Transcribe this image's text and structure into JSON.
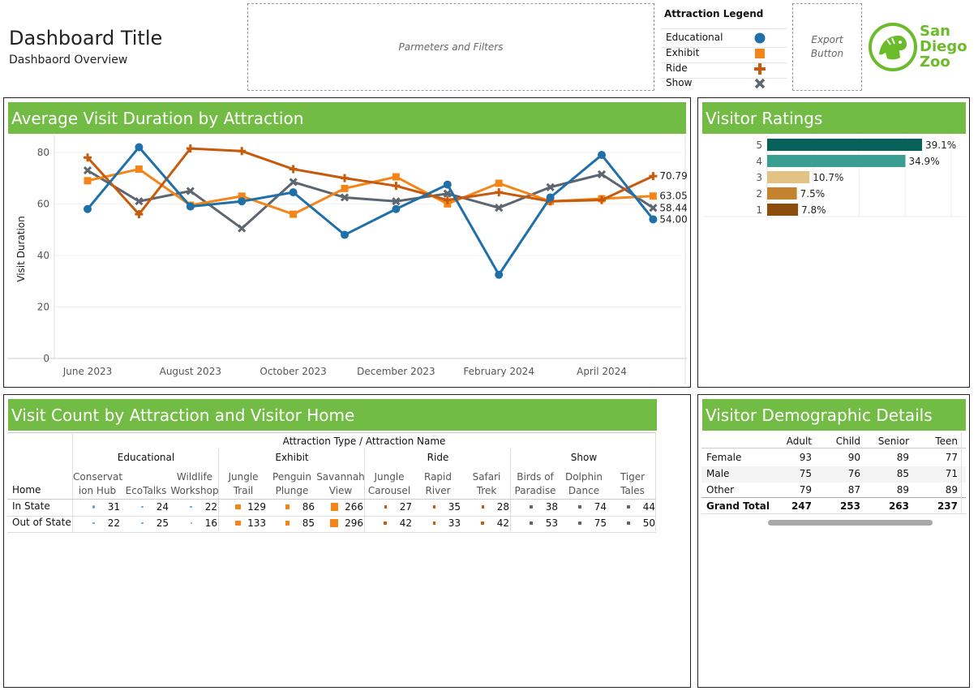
{
  "header": {
    "title": "Dashboard Title",
    "subtitle": "Dashbaord Overview",
    "filters_placeholder": "Parmeters and Filters",
    "export_line1": "Export",
    "export_line2": "Button",
    "logo_text": [
      "San",
      "Diego",
      "Zoo"
    ]
  },
  "legend": {
    "title": "Attraction Legend",
    "items": [
      {
        "label": "Educational",
        "shape": "circle",
        "color": "#1f6fa8"
      },
      {
        "label": "Exhibit",
        "shape": "square",
        "color": "#f58518"
      },
      {
        "label": "Ride",
        "shape": "plus",
        "color": "#c85a0c"
      },
      {
        "label": "Show",
        "shape": "cross",
        "color": "#5d6570"
      }
    ]
  },
  "line_panel": {
    "title": "Average Visit Duration by Attraction"
  },
  "ratings_panel": {
    "title": "Visitor Ratings"
  },
  "counts_panel": {
    "title": "Visit Count by Attraction and Visitor Home",
    "header_top": "Attraction Type / Attraction Name",
    "row_header": "Home",
    "groups": [
      "Educational",
      "Exhibit",
      "Ride",
      "Show"
    ],
    "columns": [
      [
        "Conservat",
        "ion Hub"
      ],
      [
        "",
        "EcoTalks"
      ],
      [
        "Wildlife",
        "Workshop"
      ],
      [
        "Jungle",
        "Trail"
      ],
      [
        "Penguin",
        "Plunge"
      ],
      [
        "Savannah",
        "View"
      ],
      [
        "Jungle",
        "Carousel"
      ],
      [
        "Rapid",
        "River"
      ],
      [
        "Safari",
        "Trek"
      ],
      [
        "Birds of",
        "Paradise"
      ],
      [
        "Dolphin",
        "Dance"
      ],
      [
        "Tiger",
        "Tales"
      ]
    ],
    "rows": [
      {
        "label": "In State",
        "values": [
          "31",
          "24",
          "22",
          "129",
          "86",
          "266",
          "27",
          "35",
          "28",
          "38",
          "74",
          "44"
        ]
      },
      {
        "label": "Out of State",
        "values": [
          "22",
          "25",
          "16",
          "133",
          "85",
          "296",
          "42",
          "33",
          "42",
          "53",
          "75",
          "50"
        ]
      }
    ]
  },
  "demographics_panel": {
    "title": "Visitor Demographic Details",
    "columns": [
      "Adult",
      "Child",
      "Senior",
      "Teen"
    ],
    "rows": [
      {
        "label": "Female",
        "values": [
          "93",
          "90",
          "89",
          "77"
        ]
      },
      {
        "label": "Male",
        "values": [
          "75",
          "76",
          "85",
          "71"
        ]
      },
      {
        "label": "Other",
        "values": [
          "79",
          "87",
          "89",
          "89"
        ]
      }
    ],
    "total": {
      "label": "Grand Total",
      "values": [
        "247",
        "253",
        "263",
        "237"
      ]
    }
  },
  "chart_data": [
    {
      "type": "line",
      "title": "Average Visit Duration by Attraction",
      "xlabel": "",
      "ylabel": "Visit Duration",
      "ylim": [
        0,
        85
      ],
      "y_ticks": [
        "0",
        "20",
        "40",
        "60",
        "80"
      ],
      "x": [
        "2023-06",
        "2023-07",
        "2023-08",
        "2023-09",
        "2023-10",
        "2023-11",
        "2023-12",
        "2024-01",
        "2024-02",
        "2024-03",
        "2024-04",
        "2024-05"
      ],
      "x_tick_labels": [
        {
          "label": "June 2023",
          "at": "2023-06"
        },
        {
          "label": "August 2023",
          "at": "2023-08"
        },
        {
          "label": "October 2023",
          "at": "2023-10"
        },
        {
          "label": "December 2023",
          "at": "2023-12"
        },
        {
          "label": "February 2024",
          "at": "2024-02"
        },
        {
          "label": "April 2024",
          "at": "2024-04"
        }
      ],
      "grid": true,
      "series": [
        {
          "name": "Educational",
          "color": "#1f6fa8",
          "marker": "circle",
          "values": [
            58,
            82,
            59,
            61,
            64.5,
            48,
            58,
            67.5,
            32.5,
            62.5,
            79,
            54.0
          ],
          "end_label": "54.00"
        },
        {
          "name": "Exhibit",
          "color": "#f58518",
          "marker": "square",
          "values": [
            69,
            73.5,
            59.5,
            63,
            56,
            66,
            70.5,
            60,
            68,
            61,
            62,
            63.05
          ],
          "end_label": "63.05"
        },
        {
          "name": "Ride",
          "color": "#c85a0c",
          "marker": "plus",
          "values": [
            78,
            56,
            81.5,
            80.5,
            73.5,
            70,
            67,
            61.5,
            64.5,
            61,
            61.5,
            70.79
          ],
          "end_label": "70.79"
        },
        {
          "name": "Show",
          "color": "#5d6570",
          "marker": "cross",
          "values": [
            73,
            61,
            65,
            50.5,
            68.5,
            62.5,
            61,
            64,
            58.5,
            66.5,
            71.5,
            58.44
          ],
          "end_label": "58.44"
        }
      ]
    },
    {
      "type": "bar",
      "title": "Visitor Ratings",
      "orientation": "horizontal",
      "categories": [
        "5",
        "4",
        "3",
        "2",
        "1"
      ],
      "values": [
        39.1,
        34.9,
        10.7,
        7.5,
        7.8
      ],
      "labels": [
        "39.1%",
        "34.9%",
        "10.7%",
        "7.5%",
        "7.8%"
      ],
      "colors": [
        "#08605a",
        "#3a9e93",
        "#e2c385",
        "#c2822e",
        "#8c4e0e"
      ],
      "xlim": [
        0,
        50
      ]
    }
  ]
}
